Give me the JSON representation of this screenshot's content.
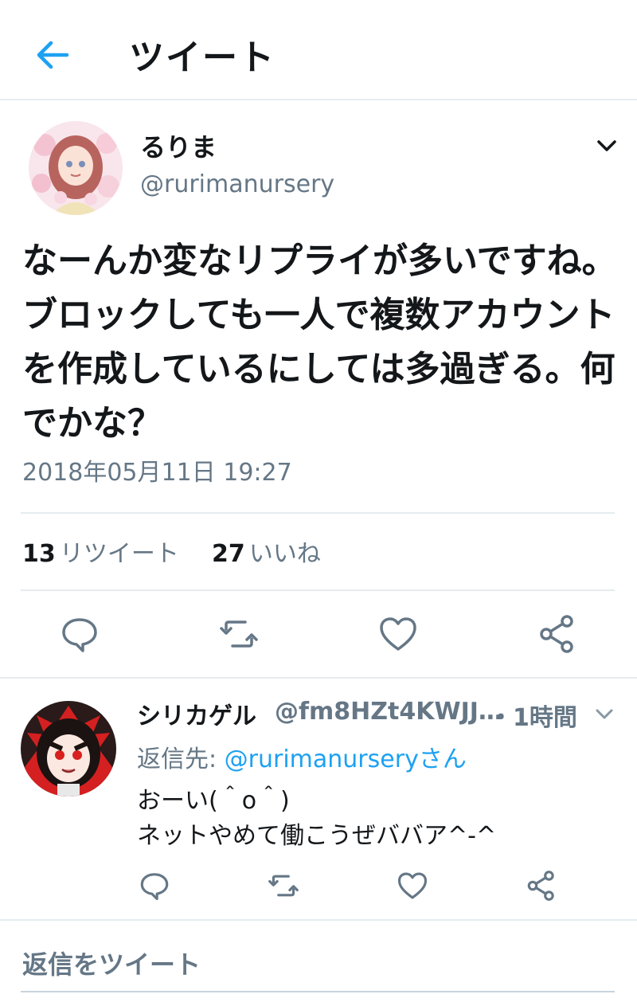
{
  "header": {
    "title": "ツイート"
  },
  "tweet": {
    "author_name": "るりま",
    "author_handle": "@rurimanursery",
    "text": "なーんか変なリプライが多いですね。ブロックしても一人で複数アカウントを作成しているにしては多過ぎる。何でかな？",
    "timestamp": "2018年05月11日 19:27",
    "retweet_count": "13",
    "retweet_label": "リツイート",
    "like_count": "27",
    "like_label": "いいね"
  },
  "reply": {
    "author_name": "シリカゲル",
    "author_handle": "@fm8HZt4KWJJ…",
    "time": "・1時間",
    "reply_to_prefix": "返信先:",
    "reply_to_mention": "@rurimanurseryさん",
    "lines": [
      "おーい(＾o＾)",
      "ネットやめて働こうぜババア^-^"
    ]
  },
  "compose": {
    "placeholder": "返信をツイート"
  },
  "colors": {
    "accent": "#1da1f2",
    "muted": "#657786",
    "text": "#14171a",
    "divider": "#e6ecf0"
  },
  "icons": [
    "back-arrow-icon",
    "chevron-down-icon",
    "reply-icon",
    "retweet-icon",
    "like-icon",
    "share-icon"
  ]
}
